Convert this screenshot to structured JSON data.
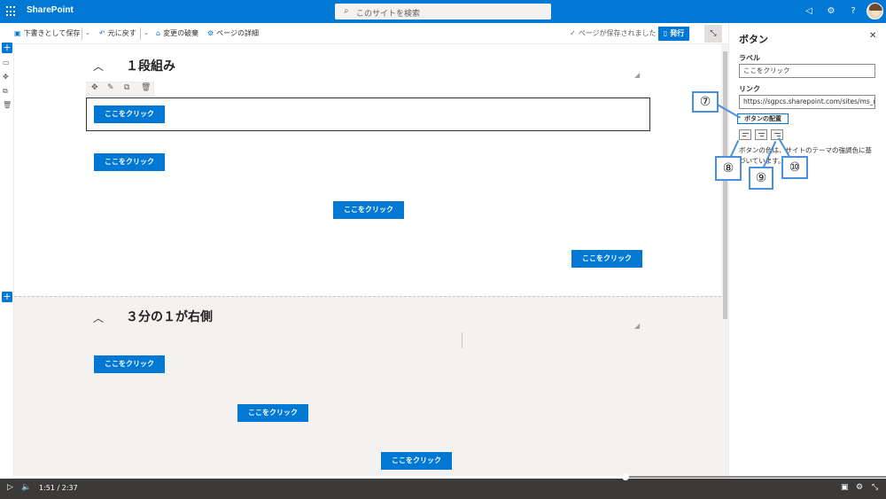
{
  "suitebar": {
    "brand": "SharePoint",
    "search_placeholder": "このサイトを検索"
  },
  "commandbar": {
    "save_draft": "下書きとして保存",
    "undo": "元に戻す",
    "discard": "変更の破棄",
    "page_details": "ページの詳細",
    "saved_status": "ページが保存されました",
    "publish": "発行"
  },
  "section1": {
    "title": "１段組み",
    "buttons": [
      "ここをクリック",
      "ここをクリック",
      "ここをクリック",
      "ここをクリック"
    ]
  },
  "section2": {
    "title": "３分の１が右側",
    "buttons": [
      "ここをクリック",
      "ここをクリック",
      "ここをクリック"
    ]
  },
  "panel": {
    "title": "ボタン",
    "label_heading": "ラベル",
    "label_value": "ここをクリック",
    "link_heading": "リンク",
    "link_value": "https://sgpcs.sharepoint.com/sites/ms_navi/...",
    "alignment_heading": "ボタンの配置",
    "note": "ボタンの色は、サイトのテーマの強調色に基づいています。"
  },
  "callouts": {
    "c7": "⑦",
    "c8": "⑧",
    "c9": "⑨",
    "c10": "⑩"
  },
  "video": {
    "time": "1:51 / 2:37",
    "progress": 0.706
  },
  "colors": {
    "accent": "#0078d4",
    "callout_border": "#4a90e2"
  }
}
